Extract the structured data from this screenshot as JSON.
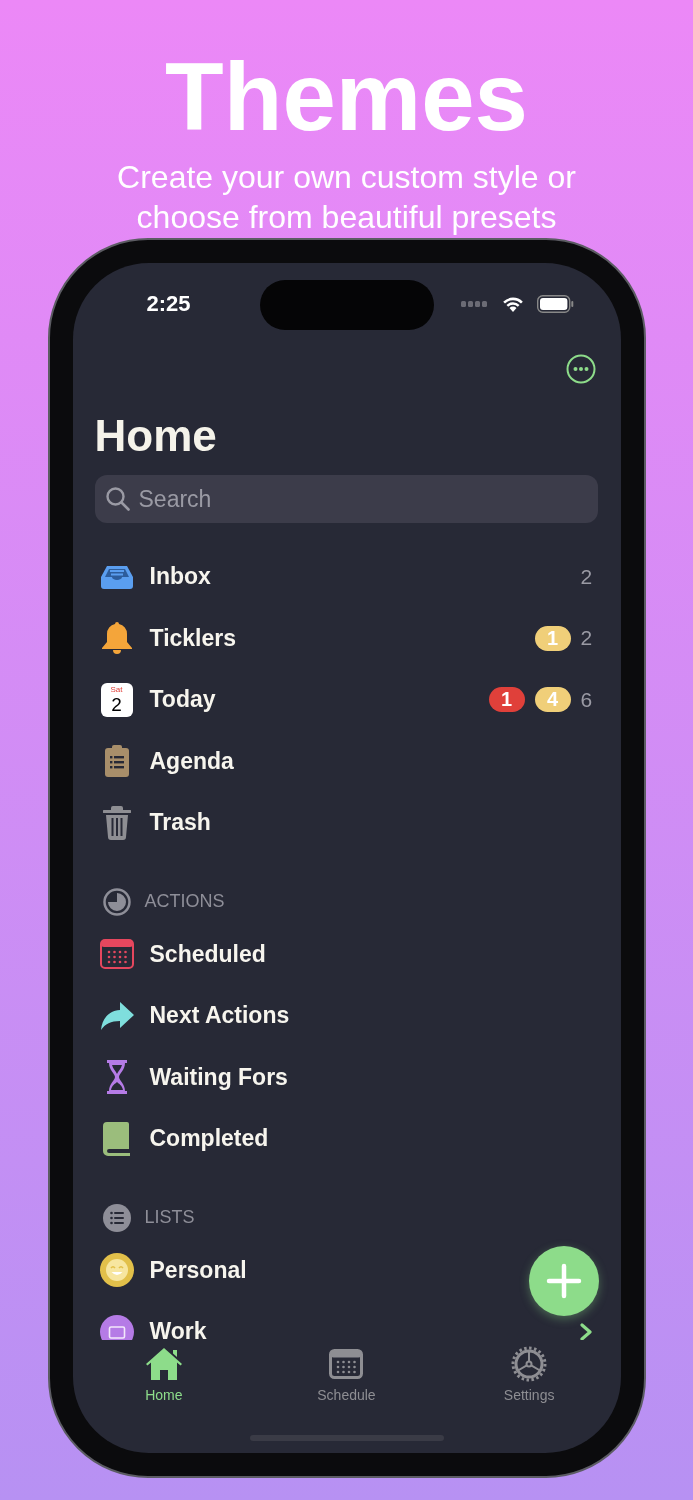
{
  "header": {
    "title": "Themes",
    "subtitle": "Create your own custom style or choose from beautiful presets"
  },
  "status_bar": {
    "time": "2:25"
  },
  "screen": {
    "title": "Home",
    "search": {
      "placeholder": "Search"
    },
    "sections": [
      {
        "rows": [
          {
            "label": "Inbox",
            "count": "2"
          },
          {
            "label": "Ticklers",
            "badges": [
              {
                "text": "1",
                "kind": "due"
              }
            ],
            "count": "2"
          },
          {
            "label": "Today",
            "date_icon": {
              "weekday": "Sat",
              "day": "2"
            },
            "badges": [
              {
                "text": "1",
                "kind": "overdue"
              },
              {
                "text": "4",
                "kind": "due"
              }
            ],
            "count": "6"
          },
          {
            "label": "Agenda"
          },
          {
            "label": "Trash"
          }
        ]
      },
      {
        "header": "ACTIONS",
        "rows": [
          {
            "label": "Scheduled"
          },
          {
            "label": "Next Actions"
          },
          {
            "label": "Waiting Fors"
          },
          {
            "label": "Completed"
          }
        ]
      },
      {
        "header": "LISTS",
        "rows": [
          {
            "label": "Personal"
          },
          {
            "label": "Work",
            "disclosure": true
          }
        ]
      }
    ]
  },
  "tabs": [
    {
      "label": "Home",
      "selected": true
    },
    {
      "label": "Schedule",
      "selected": false
    },
    {
      "label": "Settings",
      "selected": false
    }
  ]
}
